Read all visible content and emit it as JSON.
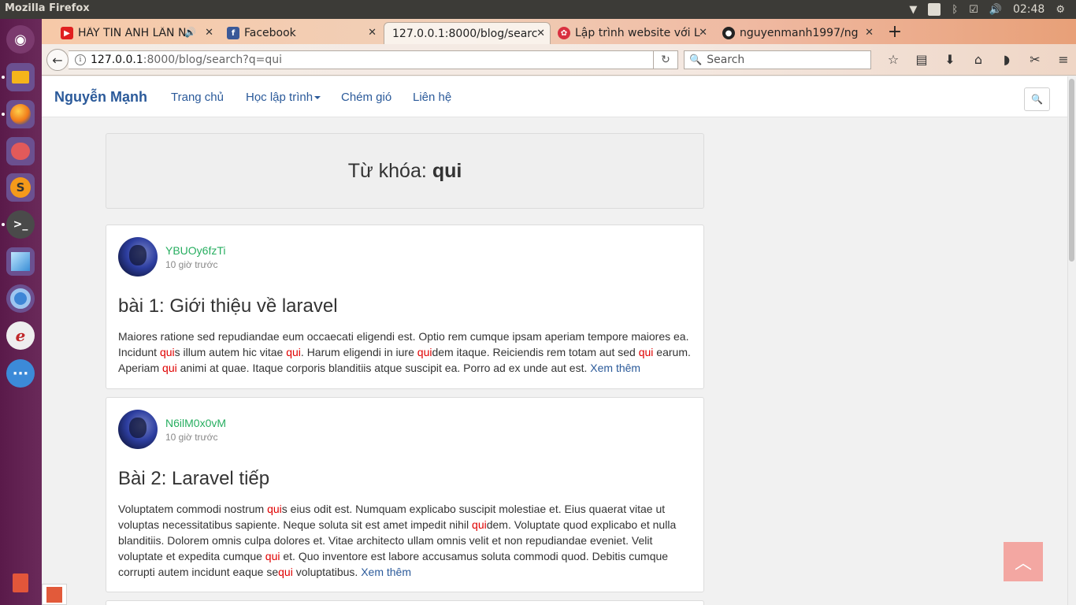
{
  "panel": {
    "app_title": "Mozilla Firefox",
    "clock": "02:48",
    "tray_b": "B"
  },
  "tabs": [
    {
      "label": "HÃY TIN ANH LẦN N",
      "icon_color": "#e02020"
    },
    {
      "label": "Facebook",
      "icon_color": "#3b5998"
    },
    {
      "label": "127.0.0.1:8000/blog/searc",
      "icon_color": "#ffffff"
    },
    {
      "label": "Lập trình website với L",
      "icon_color": "#d93040"
    },
    {
      "label": "nguyenmanh1997/ng",
      "icon_color": "#222222"
    }
  ],
  "toolbar": {
    "url_host": "127.0.0.1",
    "url_path": ":8000/blog/search?q=qui",
    "search_placeholder": "Search"
  },
  "site": {
    "brand": "Nguyễn Mạnh",
    "nav": [
      "Trang chủ",
      "Học lập trình",
      "Chém gió",
      "Liên hệ"
    ]
  },
  "search": {
    "label": "Từ khóa:",
    "keyword": "qui"
  },
  "posts": [
    {
      "author": "YBUOy6fzTi",
      "time": "10 giờ trước",
      "title": "bài 1: Giới thiệu về laravel",
      "excerpt": [
        {
          "t": "Maiores ratione sed repudiandae eum occaecati eligendi est. Optio rem cumque ipsam aperiam tempore maiores ea. Incidunt "
        },
        {
          "t": "qui",
          "hl": true
        },
        {
          "t": "s illum autem hic vitae "
        },
        {
          "t": "qui",
          "hl": true
        },
        {
          "t": ". Harum eligendi in iure "
        },
        {
          "t": "qui",
          "hl": true
        },
        {
          "t": "dem itaque. Reiciendis rem totam aut sed "
        },
        {
          "t": "qui",
          "hl": true
        },
        {
          "t": " earum. Aperiam "
        },
        {
          "t": "qui",
          "hl": true
        },
        {
          "t": " animi at quae. Itaque corporis blanditiis atque suscipit ea. Porro ad ex unde aut est. "
        }
      ],
      "more": "Xem thêm"
    },
    {
      "author": "N6ilM0x0vM",
      "time": "10 giờ trước",
      "title": "Bài 2: Laravel tiếp",
      "excerpt": [
        {
          "t": "Voluptatem commodi nostrum "
        },
        {
          "t": "qui",
          "hl": true
        },
        {
          "t": "s eius odit est. Numquam explicabo suscipit molestiae et. Eius quaerat vitae ut voluptas necessitatibus sapiente. Neque soluta sit est amet impedit nihil "
        },
        {
          "t": "qui",
          "hl": true
        },
        {
          "t": "dem. Voluptate quod explicabo et nulla blanditiis. Dolorem omnis culpa dolores et. Vitae architecto ullam omnis velit et non repudiandae eveniet. Velit voluptate et expedita cumque "
        },
        {
          "t": "qui",
          "hl": true
        },
        {
          "t": " et. Quo inventore est labore accusamus soluta commodi quod. Debitis cumque corrupti autem incidunt eaque se"
        },
        {
          "t": "qui",
          "hl": true
        },
        {
          "t": " voluptatibus. "
        }
      ],
      "more": "Xem thêm"
    }
  ],
  "colors": {
    "brand": "#2b5a9a",
    "author": "#27ae60",
    "highlight": "#e00000",
    "back_to_top": "#f3a7a2"
  },
  "icons": {
    "launcher": [
      "ubuntu-dash-icon",
      "files-icon",
      "firefox-icon",
      "settings-toggle-icon",
      "sublime-text-icon",
      "terminal-icon",
      "virtualbox-icon",
      "chromium-icon",
      "eclipse-icon",
      "more-apps-icon",
      "trash-icon"
    ]
  }
}
